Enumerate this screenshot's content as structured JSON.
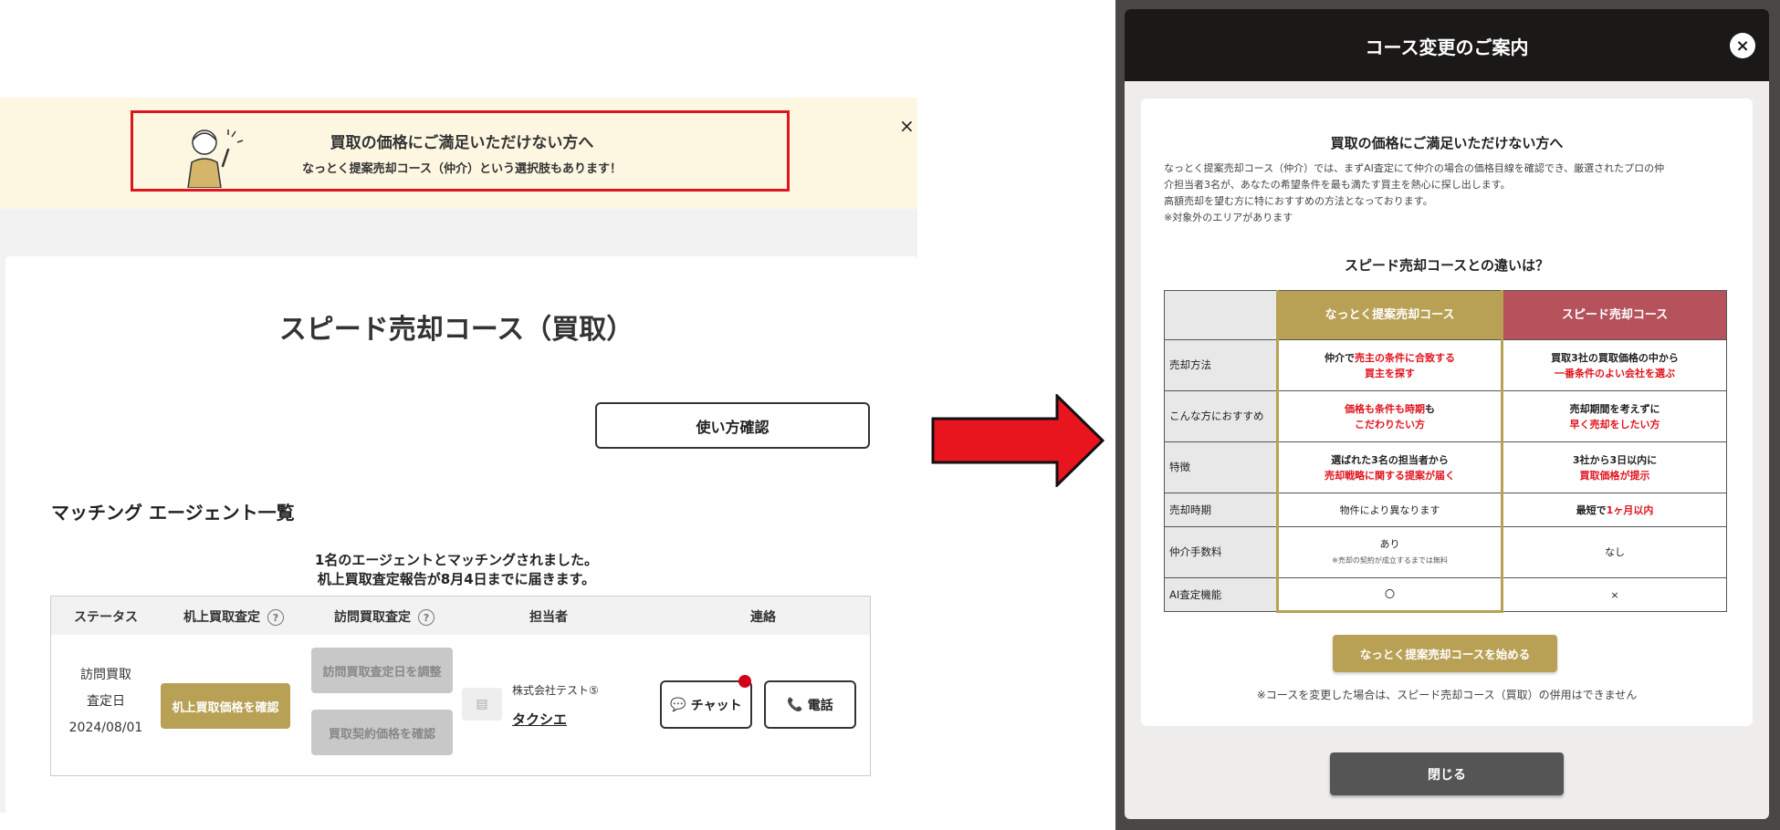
{
  "left_panel": {
    "banner": {
      "title": "買取の価格にご満足いただけない方へ",
      "subtitle": "なっとく提案売却コース（仲介）という選択肢もあります！",
      "close_symbol": "×"
    },
    "course_title": "スピード売却コース（買取）",
    "howto_button": "使い方確認",
    "agent_list_heading": "マッチング エージェント一覧",
    "match_message_line1": "1名のエージェントとマッチングされました。",
    "match_message_line2": "机上買取査定報告が8月4日までに届きます。",
    "table_headers": {
      "status": "ステータス",
      "desk_appraisal": "机上買取査定",
      "visit_appraisal": "訪問買取査定",
      "agent": "担当者",
      "contact": "連絡",
      "help_symbol": "?"
    },
    "row": {
      "status_line1": "訪問買取",
      "status_line2": "査定日",
      "status_date": "2024/08/01",
      "desk_button": "机上買取価格を確認",
      "visit_button_1": "訪問買取査定日を調整",
      "visit_button_2": "買取契約価格を確認",
      "company": "株式会社テスト⑤",
      "agent_name": "タクシエ",
      "chat_button": "チャット",
      "phone_button": "電話"
    },
    "colors": {
      "banner_bg": "#fdf7e2",
      "highlight_border": "#e0141e",
      "gold": "#b8a055",
      "notif": "#d0021b"
    }
  },
  "modal": {
    "title": "コース変更のご案内",
    "close_symbol": "×",
    "body_title": "買取の価格にご満足いただけない方へ",
    "description": [
      "なっとく提案売却コース（仲介）では、まずAI査定にて仲介の場合の価格目線を確認でき、厳選されたプロの仲",
      "介担当者3名が、あなたの希望条件を最も満たす買主を熱心に探し出します。",
      "高額売却を望む方に特におすすめの方法となっております。",
      "※対象外のエリアがあります"
    ],
    "diff_heading": "スピード売却コースとの違いは？",
    "comparison": {
      "col1_header": "なっとく提案売却コース",
      "col2_header": "スピード売却コース",
      "rows": [
        {
          "label": "売却方法",
          "c1_a": "仲介で",
          "c1_b": "売主の条件に合致する",
          "c1_c": "買主を探す",
          "c2_a": "買取3社の買取価格の中から",
          "c2_b": "一番条件のよい会社を選ぶ"
        },
        {
          "label": "こんな方におすすめ",
          "c1_a": "価格も条件も時期",
          "c1_b": "も",
          "c1_c": "こだわりたい方",
          "c2_a": "売却期間を考えずに",
          "c2_b": "早く売却をしたい方"
        },
        {
          "label": "特徴",
          "c1_a": "選ばれた3名の担当者から",
          "c1_b": "売却戦略に関する提案が届く",
          "c2_a": "3社から3日以内に",
          "c2_b": "買取価格が提示"
        },
        {
          "label": "売却時期",
          "c1_a": "物件により異なります",
          "c2_a": "最短で",
          "c2_b": "1ヶ月以内"
        },
        {
          "label": "仲介手数料",
          "c1_a": "あり",
          "c1_b": "※売却の契約が成立するまでは無料",
          "c2_a": "なし"
        },
        {
          "label": "AI査定機能",
          "c1_a": "〇",
          "c2_a": "×"
        }
      ]
    },
    "start_button": "なっとく提案売却コースを始める",
    "note": "※コースを変更した場合は、スピード売却コース（買取）の併用はできません",
    "close_button": "閉じる",
    "colors": {
      "header_bg": "#1a1918",
      "gold": "#b8a055",
      "red_header": "#b5525c",
      "emphasis": "#e0141e"
    }
  },
  "arrow_color": "#e8141e"
}
